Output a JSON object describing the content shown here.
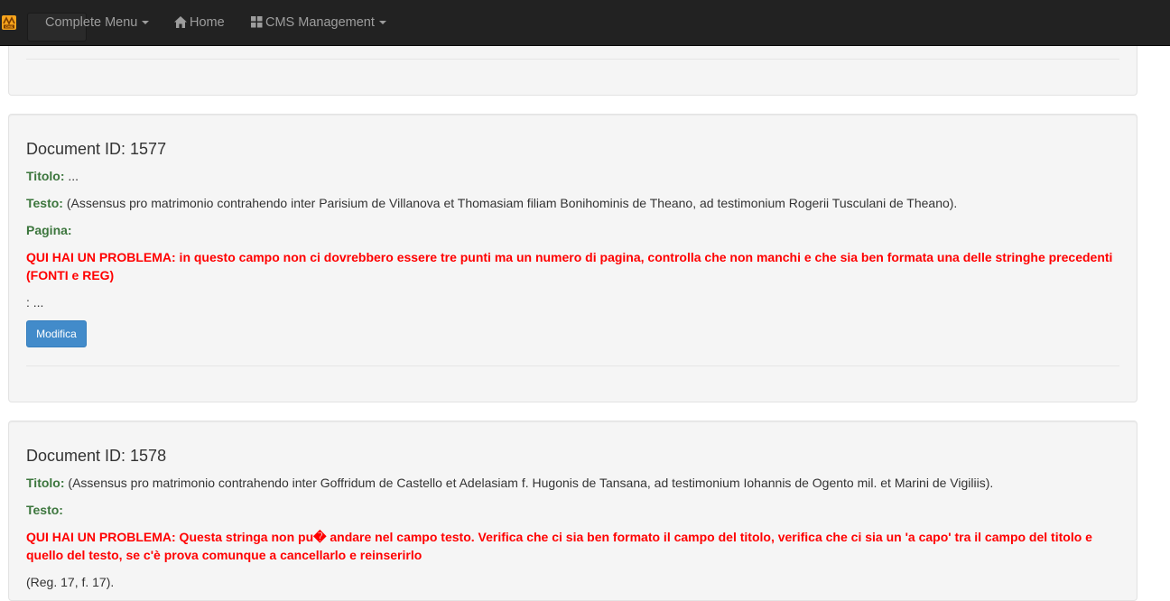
{
  "navbar": {
    "logo": "cms-logo-icon",
    "items": [
      {
        "label": "Complete Menu",
        "icon": "caret-down-icon"
      },
      {
        "label": "Home",
        "icon": "home-icon"
      },
      {
        "label": "CMS Management",
        "icon": "grid-icon"
      }
    ]
  },
  "documents": [
    {
      "heading": "Document ID: 1577",
      "titolo_label": "Titolo:",
      "titolo_value": "...",
      "testo_label": "Testo:",
      "testo_value": "(Assensus pro matrimonio contrahendo inter Parisium de Villanova et Thomasiam filiam Bonihominis de Theano, ad testimonium Rogerii Tusculani de Theano).",
      "pagina_label": "Pagina:",
      "problem": "QUI HAI UN PROBLEMA: in questo campo non ci dovrebbero essere tre punti ma un numero di pagina, controlla che non manchi e che sia ben formata una delle stringhe precedenti (FONTI e REG)",
      "pagina_value": ": ...",
      "button": "Modifica"
    },
    {
      "heading": "Document ID: 1578",
      "titolo_label": "Titolo:",
      "titolo_value": "(Assensus pro matrimonio contrahendo inter Goffridum de Castello et Adelasiam f. Hugonis de Tansana, ad testimonium Iohannis de Ogento mil. et Marini de Vigiliis).",
      "testo_label": "Testo:",
      "problem": "QUI HAI UN PROBLEMA: Questa stringa non pu� andare nel campo testo. Verifica che ci sia ben formato il campo del titolo, verifica che ci sia un 'a capo' tra il campo del titolo e quello del testo, se c'è prova comunque a cancellarlo e reinserirlo",
      "ref": "(Reg. 17, f. 17)."
    }
  ]
}
